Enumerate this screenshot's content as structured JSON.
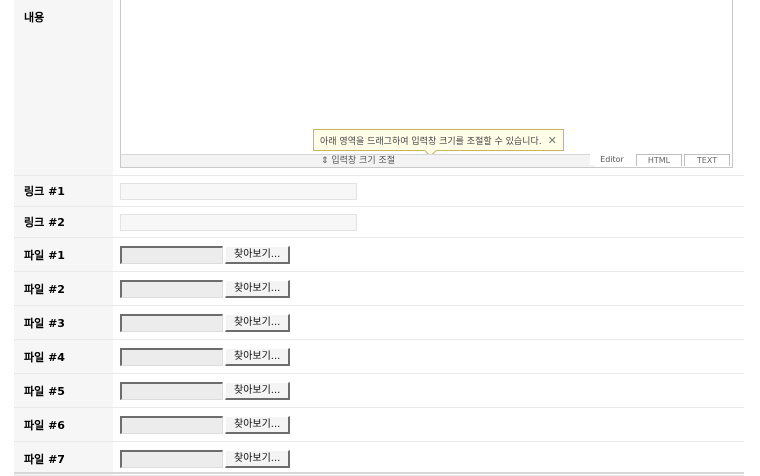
{
  "content": {
    "label": "내용",
    "resize_label": "⇕ 입력창 크기 조절",
    "tooltip": "아래 영역을 드래그하여 입력창 크기를 조절할 수 있습니다.",
    "tooltip_close": "✕",
    "modes": [
      "Editor",
      "HTML",
      "TEXT"
    ]
  },
  "links": [
    {
      "label": "링크 #1",
      "value": ""
    },
    {
      "label": "링크 #2",
      "value": ""
    }
  ],
  "browse_label": "찾아보기...",
  "files": [
    {
      "label": "파일 #1"
    },
    {
      "label": "파일 #2"
    },
    {
      "label": "파일 #3"
    },
    {
      "label": "파일 #4"
    },
    {
      "label": "파일 #5"
    },
    {
      "label": "파일 #6"
    },
    {
      "label": "파일 #7"
    }
  ]
}
